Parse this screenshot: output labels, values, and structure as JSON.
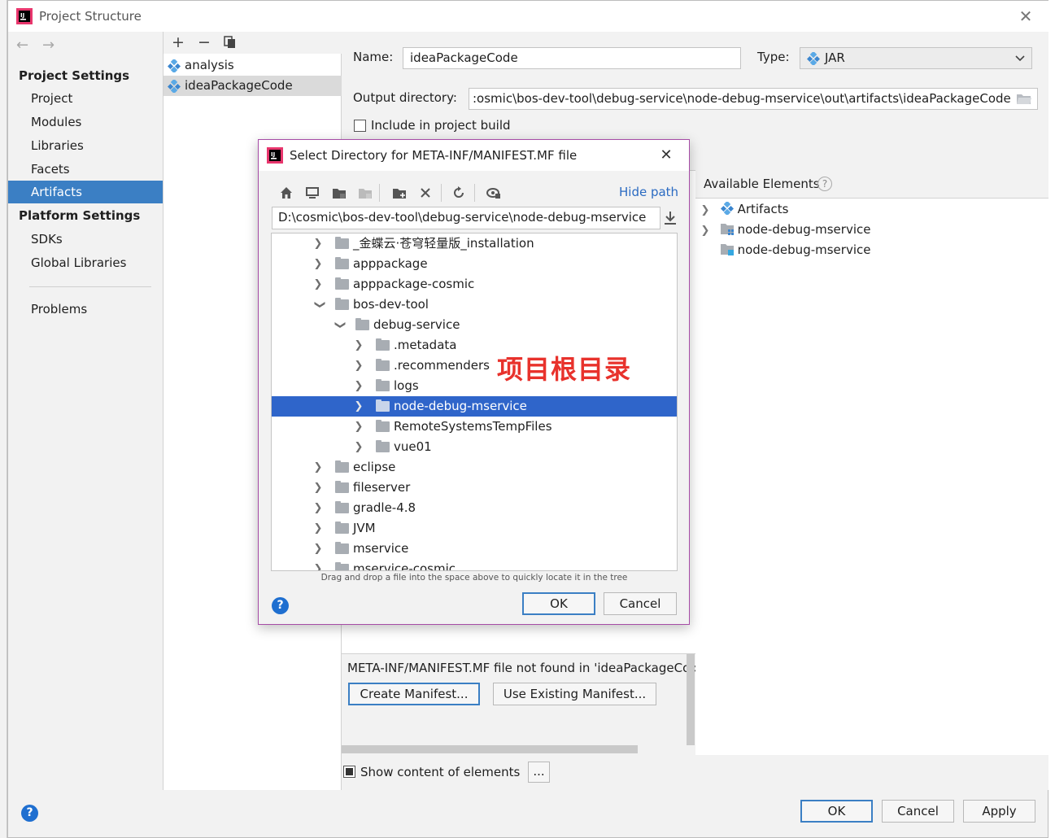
{
  "window": {
    "title": "Project Structure",
    "close_glyph": "✕"
  },
  "sidebar": {
    "back_glyph": "←",
    "forward_glyph": "→",
    "project_settings_heading": "Project Settings",
    "project_items": [
      "Project",
      "Modules",
      "Libraries",
      "Facets",
      "Artifacts"
    ],
    "platform_settings_heading": "Platform Settings",
    "platform_items": [
      "SDKs",
      "Global Libraries"
    ],
    "problems": "Problems",
    "selected": "Artifacts"
  },
  "artifacts": {
    "add_glyph": "+",
    "remove_glyph": "−",
    "items": [
      "analysis",
      "ideaPackageCode"
    ],
    "selected": "ideaPackageCode"
  },
  "config": {
    "name_label": "Name:",
    "name_value": "ideaPackageCode",
    "type_label": "Type:",
    "type_value": "JAR",
    "output_dir_label": "Output directory:",
    "output_dir_value": ":osmic\\bos-dev-tool\\debug-service\\node-debug-mservice\\out\\artifacts\\ideaPackageCode",
    "include_in_build_label": "Include in project build",
    "include_in_build_checked": false,
    "available_elements_label": "Available Elements",
    "available_elements": [
      {
        "label": "Artifacts",
        "expandable": true,
        "icon": "artifacts-icon"
      },
      {
        "label": "node-debug-mservice",
        "expandable": true,
        "icon": "module-icon"
      },
      {
        "label": "node-debug-mservice",
        "expandable": false,
        "icon": "module-icon"
      }
    ],
    "manifest_message": "META-INF/MANIFEST.MF file not found in 'ideaPackageCod",
    "create_manifest": "Create Manifest...",
    "use_existing_manifest": "Use Existing Manifest...",
    "show_content_label": "Show content of elements",
    "show_content_checked": true,
    "ellipsis_button": "..."
  },
  "footer": {
    "ok": "OK",
    "cancel": "Cancel",
    "apply": "Apply",
    "help_glyph": "?"
  },
  "dialog": {
    "title": "Select Directory for META-INF/MANIFEST.MF file",
    "close_glyph": "✕",
    "hide_path": "Hide path",
    "path_value": "D:\\cosmic\\bos-dev-tool\\debug-service\\node-debug-mservice",
    "tree": [
      {
        "label": "_金蝶云·苍穹轻量版_installation",
        "depth": 0,
        "expanded": false
      },
      {
        "label": "apppackage",
        "depth": 0,
        "expanded": false
      },
      {
        "label": "apppackage-cosmic",
        "depth": 0,
        "expanded": false
      },
      {
        "label": "bos-dev-tool",
        "depth": 0,
        "expanded": true
      },
      {
        "label": "debug-service",
        "depth": 1,
        "expanded": true
      },
      {
        "label": ".metadata",
        "depth": 2,
        "expanded": false
      },
      {
        "label": ".recommenders",
        "depth": 2,
        "expanded": false
      },
      {
        "label": "logs",
        "depth": 2,
        "expanded": false
      },
      {
        "label": "node-debug-mservice",
        "depth": 2,
        "expanded": false,
        "selected": true
      },
      {
        "label": "RemoteSystemsTempFiles",
        "depth": 2,
        "expanded": false
      },
      {
        "label": "vue01",
        "depth": 2,
        "expanded": false
      },
      {
        "label": "eclipse",
        "depth": 0,
        "expanded": false
      },
      {
        "label": "fileserver",
        "depth": 0,
        "expanded": false
      },
      {
        "label": "gradle-4.8",
        "depth": 0,
        "expanded": false
      },
      {
        "label": "JVM",
        "depth": 0,
        "expanded": false
      },
      {
        "label": "mservice",
        "depth": 0,
        "expanded": false
      },
      {
        "label": "mservice-cosmic",
        "depth": 0,
        "expanded": false
      }
    ],
    "drag_hint": "Drag and drop a file into the space above to quickly locate it in the tree",
    "ok": "OK",
    "cancel": "Cancel",
    "help_glyph": "?",
    "annotation": "项目根目录"
  },
  "colors": {
    "selection": "#3b7fc4",
    "tree_selection": "#2f65ca",
    "annotation": "#e8322c",
    "dialog_border": "#a64ca6"
  }
}
